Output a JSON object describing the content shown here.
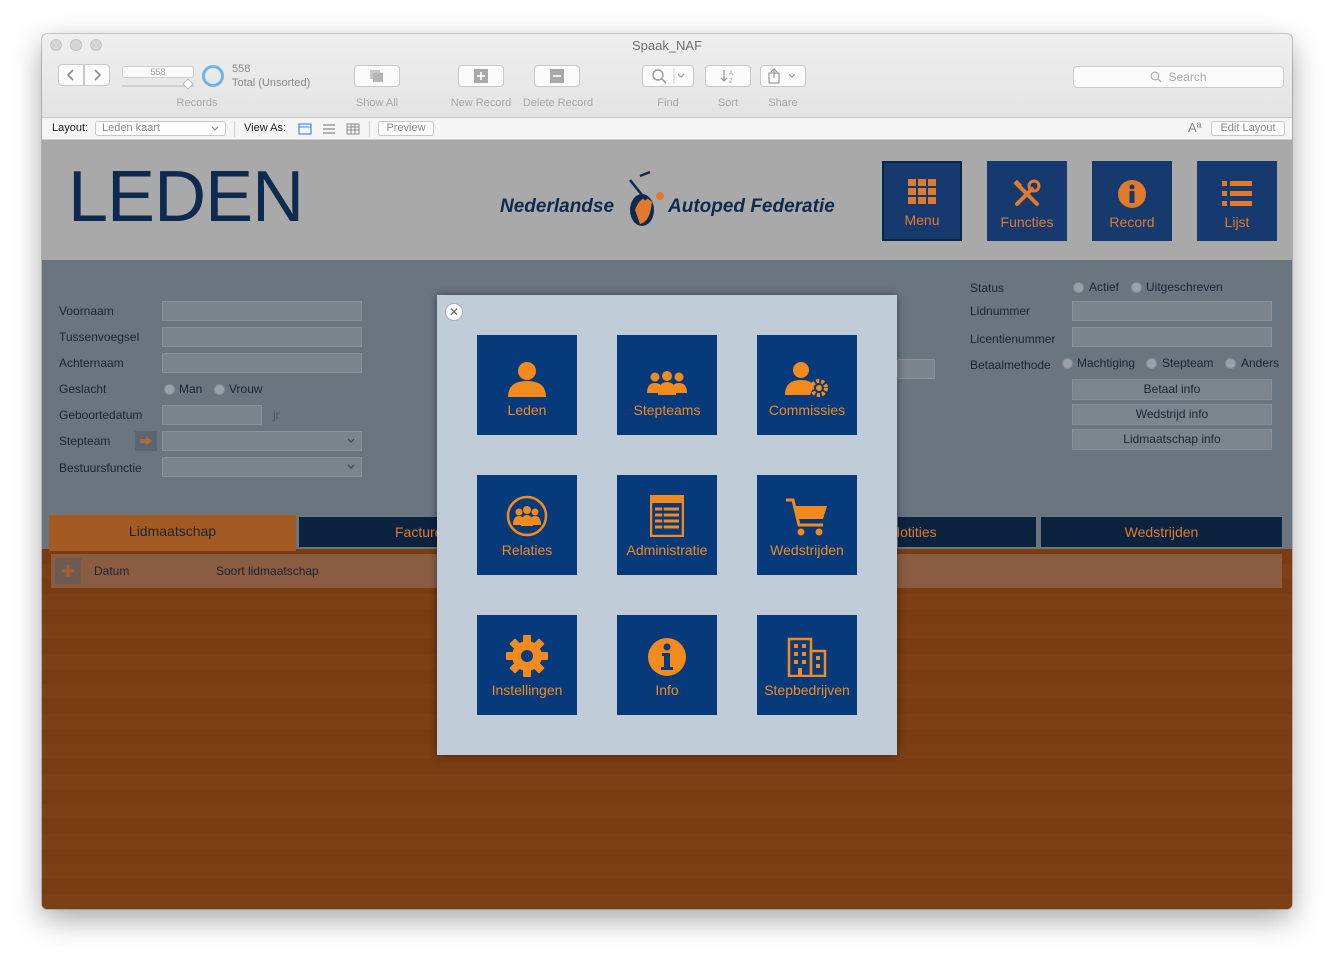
{
  "window": {
    "title": "Spaak_NAF"
  },
  "toolbar": {
    "record_slider_value": "558",
    "records_label": "Records",
    "record_count": "558",
    "record_status": "Total (Unsorted)",
    "show_all_label": "Show All",
    "new_record_label": "New Record",
    "delete_record_label": "Delete Record",
    "find_label": "Find",
    "sort_label": "Sort",
    "share_label": "Share",
    "search_placeholder": "Search"
  },
  "layoutbar": {
    "layout_label": "Layout:",
    "layout_value": "Leden kaart",
    "view_as_label": "View As:",
    "preview_label": "Preview",
    "font_size_glyph": "Aª",
    "edit_layout_label": "Edit Layout"
  },
  "header": {
    "title": "LEDEN",
    "logo_text_left": "Nederlandse",
    "logo_text_right": "Autoped Federatie",
    "nav": [
      {
        "label": "Menu",
        "icon": "grid-icon"
      },
      {
        "label": "Functies",
        "icon": "tools-icon"
      },
      {
        "label": "Record",
        "icon": "info-icon"
      },
      {
        "label": "Lijst",
        "icon": "list-icon"
      }
    ]
  },
  "form": {
    "voornaam": "Voornaam",
    "tussenvoegsel": "Tussenvoegsel",
    "achternaam": "Achternaam",
    "geslacht": "Geslacht",
    "man": "Man",
    "vrouw": "Vrouw",
    "geboortedatum": "Geboortedatum",
    "jr": "jr",
    "stepteam": "Stepteam",
    "bestuursfunctie": "Bestuursfunctie",
    "status": "Status",
    "actief": "Actief",
    "uitgeschreven": "Uitgeschreven",
    "lidnummer": "Lidnummer",
    "licentienummer": "Licentienummer",
    "betaalmethode": "Betaalmethode",
    "machtiging": "Machtiging",
    "stepteam_option": "Stepteam",
    "anders": "Anders",
    "betaal_info": "Betaal info",
    "wedstrijd_info": "Wedstrijd info",
    "lidmaatschap_info": "Lidmaatschap info"
  },
  "tabs": [
    "Lidmaatschap",
    "Facture",
    "Notities",
    "Wedstrijden"
  ],
  "portal": {
    "datum": "Datum",
    "soort": "Soort lidmaatschap"
  },
  "modal": {
    "tiles": [
      {
        "label": "Leden",
        "icon": "person-icon"
      },
      {
        "label": "Stepteams",
        "icon": "group-icon"
      },
      {
        "label": "Commissies",
        "icon": "person-gear-icon"
      },
      {
        "label": "Relaties",
        "icon": "circle-group-icon"
      },
      {
        "label": "Administratie",
        "icon": "ledger-icon"
      },
      {
        "label": "Wedstrijden",
        "icon": "cart-icon"
      },
      {
        "label": "Instellingen",
        "icon": "gear-icon"
      },
      {
        "label": "Info",
        "icon": "info-icon"
      },
      {
        "label": "Stepbedrijven",
        "icon": "building-icon"
      }
    ]
  },
  "colors": {
    "accent_orange": "#f28a1e",
    "tile_blue": "#063a7a",
    "nav_blue": "#163a6e",
    "header_navy": "#0f2a4f"
  }
}
